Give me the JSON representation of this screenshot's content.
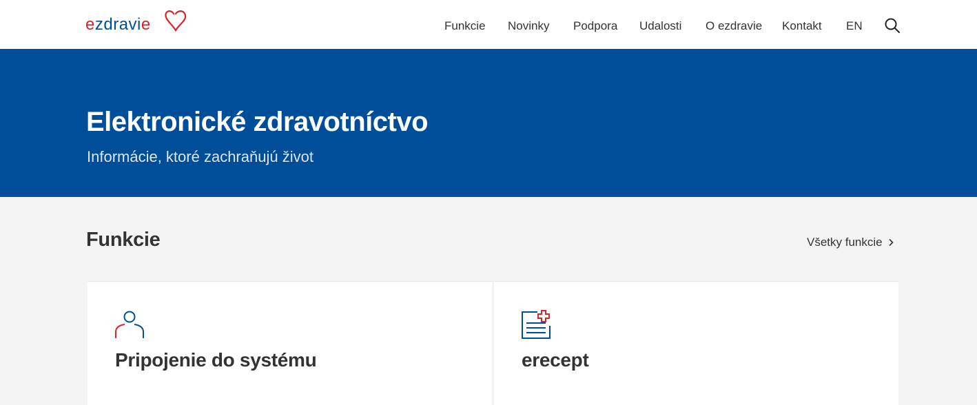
{
  "header": {
    "logo_text": "ezdravie",
    "nav": [
      {
        "label": "Funkcie"
      },
      {
        "label": "Novinky"
      },
      {
        "label": "Podpora"
      },
      {
        "label": "Udalosti"
      },
      {
        "label": "O ezdravie"
      },
      {
        "label": "Kontakt"
      },
      {
        "label": "EN"
      }
    ],
    "search_icon": "search-icon"
  },
  "hero": {
    "title": "Elektronické zdravotníctvo",
    "subtitle": "Informácie, ktoré zachraňujú život"
  },
  "section": {
    "title": "Funkcie",
    "all_link": "Všetky funkcie"
  },
  "cards": [
    {
      "title": "Pripojenie do systému",
      "icon": "user-icon"
    },
    {
      "title": "erecept",
      "icon": "prescription-icon"
    }
  ],
  "colors": {
    "primary_blue": "#004e99",
    "accent_red": "#d8232a",
    "background": "#f4f4f4"
  }
}
